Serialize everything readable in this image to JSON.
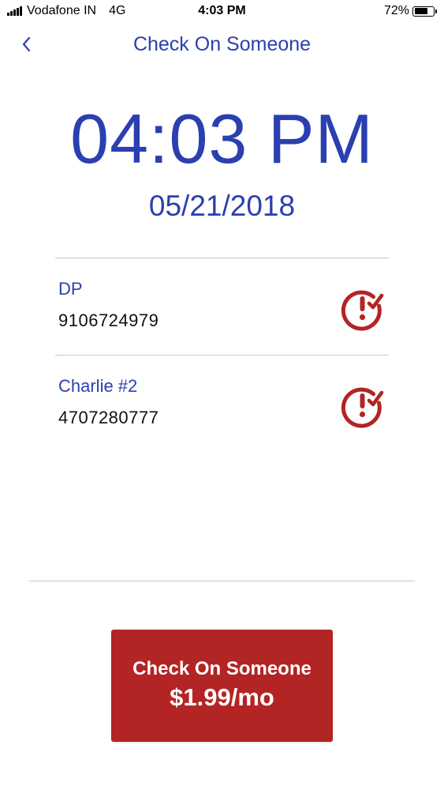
{
  "status_bar": {
    "carrier": "Vodafone IN",
    "network": "4G",
    "time": "4:03 PM",
    "battery_percent": "72%"
  },
  "nav": {
    "back_icon": "chevron-left-icon",
    "title": "Check On Someone"
  },
  "clock": {
    "time": "04:03 PM",
    "date": "05/21/2018"
  },
  "contacts": [
    {
      "name": "DP",
      "phone": "9106724979",
      "icon": "clock-alert-check-icon"
    },
    {
      "name": "Charlie #2",
      "phone": "4707280777",
      "icon": "clock-alert-check-icon"
    }
  ],
  "cta": {
    "line1": "Check On Someone",
    "line2": "$1.99/mo"
  },
  "colors": {
    "primary_blue": "#2b3fb0",
    "accent_red": "#b32424",
    "divider": "#c8c8c8"
  }
}
